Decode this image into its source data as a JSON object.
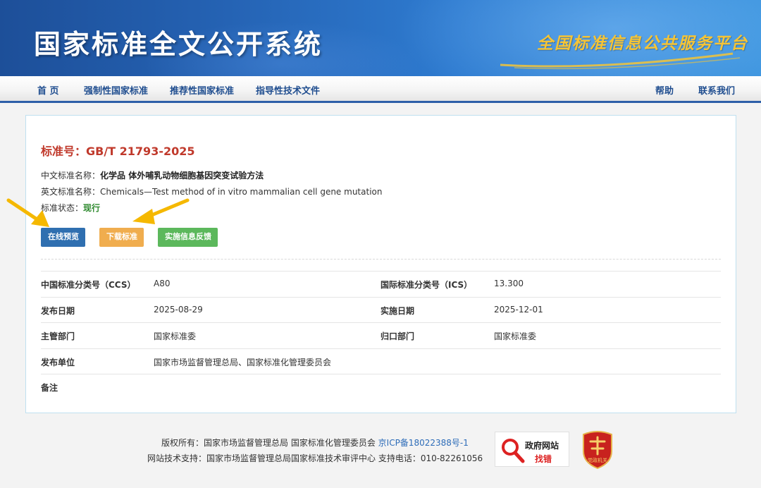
{
  "banner": {
    "title": "国家标准全文公开系统",
    "slogan": "全国标准信息公共服务平台"
  },
  "nav": {
    "left": [
      {
        "label": "首 页"
      },
      {
        "label": "强制性国家标准"
      },
      {
        "label": "推荐性国家标准"
      },
      {
        "label": "指导性技术文件"
      }
    ],
    "right": [
      {
        "label": "帮助"
      },
      {
        "label": "联系我们"
      }
    ]
  },
  "standard": {
    "number": "标准号：GB/T 21793-2025",
    "cn_name_label": "中文标准名称：",
    "cn_name": "化学品 体外哺乳动物细胞基因突变试验方法",
    "en_name_label": "英文标准名称：",
    "en_name": "Chemicals—Test method of in vitro mammalian cell gene mutation",
    "status_label": "标准状态：",
    "status": "现行"
  },
  "buttons": {
    "preview": "在线预览",
    "download": "下载标准",
    "feedback": "实施信息反馈"
  },
  "details": {
    "ccs_label": "中国标准分类号（CCS）",
    "ccs": "A80",
    "ics_label": "国际标准分类号（ICS）",
    "ics": "13.300",
    "publish_date_label": "发布日期",
    "publish_date": "2025-08-29",
    "implement_date_label": "实施日期",
    "implement_date": "2025-12-01",
    "authority_label": "主管部门",
    "authority": "国家标准委",
    "owner_label": "归口部门",
    "owner": "国家标准委",
    "publisher_label": "发布单位",
    "publisher": "国家市场监督管理总局、国家标准化管理委员会",
    "remark_label": "备注",
    "remark": ""
  },
  "footer": {
    "copyright": "版权所有：国家市场监督管理总局 国家标准化管理委员会",
    "icp": "京ICP备18022388号-1",
    "support": "网站技术支持：国家市场监督管理总局国家标准技术审评中心 支持电话：010-82261056",
    "gov_badge_top": "政府网站",
    "gov_badge_bottom": "找错",
    "party_badge": "党政机关"
  },
  "colors": {
    "accent_blue": "#2d5fa8",
    "standard_red": "#c0392b",
    "status_green": "#2f8a2f",
    "arrow_yellow": "#f5b800"
  }
}
